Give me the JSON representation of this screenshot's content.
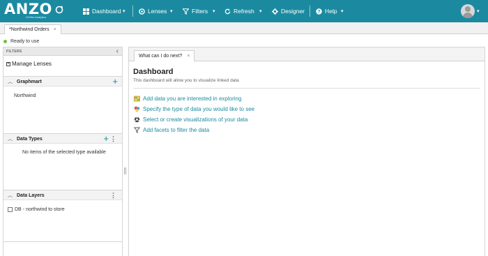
{
  "header": {
    "logo_text": "ANZO",
    "logo_sub": "Hi-Res Analytics",
    "nav": [
      {
        "label": "Dashboard",
        "icon": "dashboard-icon"
      },
      {
        "label": "Lenses",
        "icon": "lenses-icon"
      },
      {
        "label": "Filters",
        "icon": "filter-icon"
      },
      {
        "label": "Refresh",
        "icon": "refresh-icon"
      },
      {
        "label": "Designer",
        "icon": "gear-icon"
      },
      {
        "label": "Help",
        "icon": "help-icon"
      }
    ],
    "accent": "#1b8aa0"
  },
  "doc_tab": {
    "label": "*Northwind Orders",
    "close": "×"
  },
  "status": {
    "text": "Ready to use",
    "color": "#6fbf3a"
  },
  "left_panel": {
    "filters_label": "FILTERS",
    "collapse": "‹",
    "manage_lenses": "Manage Lenses",
    "graphmart": {
      "title": "Graphmart",
      "items": [
        "Northwind"
      ]
    },
    "data_types": {
      "title": "Data Types",
      "empty_text": "No items of the selected type available"
    },
    "data_layers": {
      "title": "Data Layers",
      "items": [
        "DB - northwind to store"
      ]
    }
  },
  "main": {
    "tab_label": "What can I do next?",
    "tab_close": "×",
    "title": "Dashboard",
    "subtitle": "This dashboard will allow you to visualize linked data",
    "links": [
      {
        "label": "Add data you are interested in exploring",
        "icon": "add-data-icon"
      },
      {
        "label": "Specify the type of data you would like to see",
        "icon": "types-icon"
      },
      {
        "label": "Select or create visualizations of your data",
        "icon": "visualization-icon"
      },
      {
        "label": "Add facets to filter the data",
        "icon": "filter-icon"
      }
    ]
  }
}
